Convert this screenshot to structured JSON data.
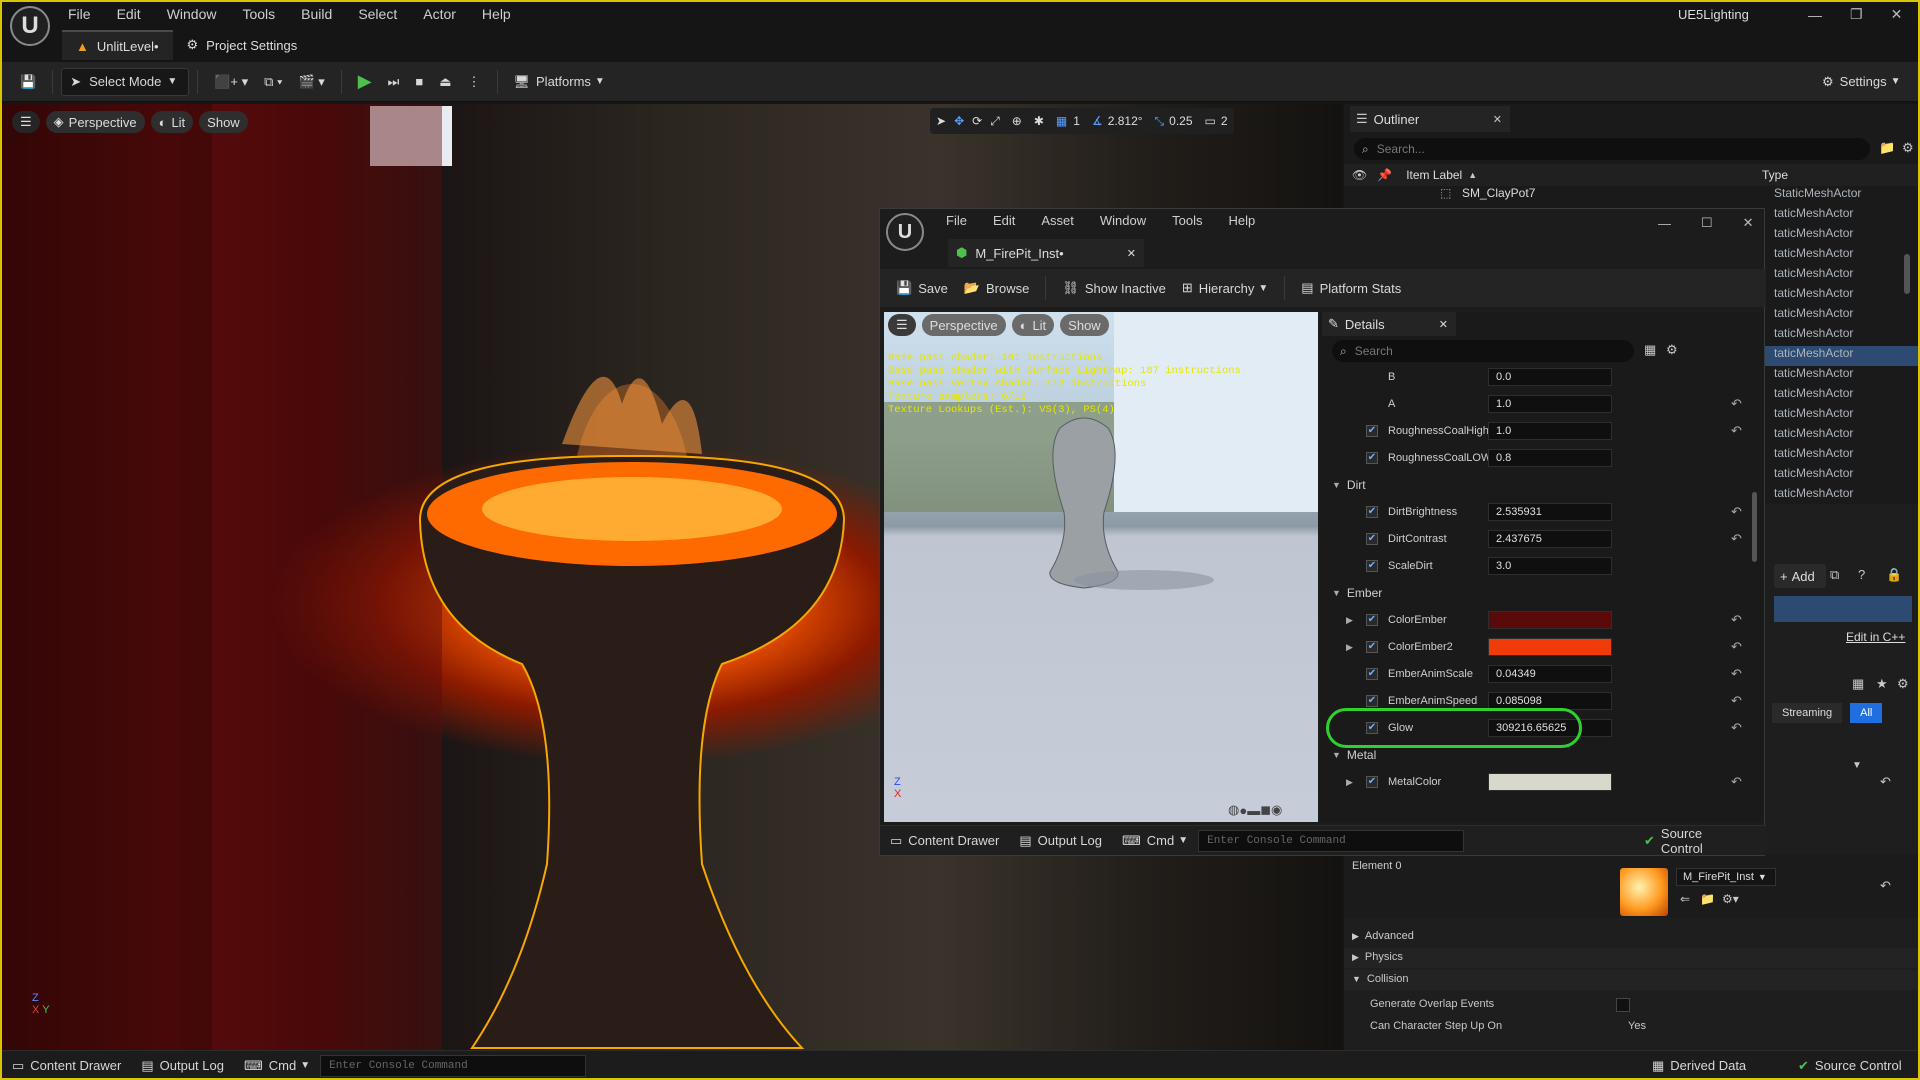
{
  "menu": [
    "File",
    "Edit",
    "Window",
    "Tools",
    "Build",
    "Select",
    "Actor",
    "Help"
  ],
  "project_name": "UE5Lighting",
  "tabs": {
    "level": "UnlitLevel•",
    "settings": "Project Settings"
  },
  "toolbar": {
    "select_mode": "Select Mode",
    "platforms": "Platforms",
    "settings": "Settings"
  },
  "viewport": {
    "perspective": "Perspective",
    "lit": "Lit",
    "show": "Show",
    "angle": "2.812°",
    "scale": "0.25",
    "grid": "1",
    "camera_speed": "2"
  },
  "material_editor": {
    "menu": [
      "File",
      "Edit",
      "Asset",
      "Window",
      "Tools",
      "Help"
    ],
    "tab": "M_FirePit_Inst•",
    "toolbar": {
      "save": "Save",
      "browse": "Browse",
      "show_inactive": "Show Inactive",
      "hierarchy": "Hierarchy",
      "platform_stats": "Platform Stats"
    },
    "preview": {
      "perspective": "Perspective",
      "lit": "Lit",
      "show": "Show",
      "stats": [
        "Base pass shader: 161 instructions",
        "Base pass shader with Surface Lightmap: 187 instructions",
        "Base pass vertex shader: 112 instructions",
        "Texture samplers: 6/16",
        "Texture Lookups (Est.): VS(3), PS(4)"
      ]
    },
    "details": {
      "tab": "Details",
      "search_placeholder": "Search",
      "rows": [
        {
          "label": "B",
          "value": "0.0"
        },
        {
          "label": "A",
          "value": "1.0"
        },
        {
          "label": "RoughnessCoalHigh",
          "value": "1.0"
        },
        {
          "label": "RoughnessCoalLOW",
          "value": "0.8"
        },
        {
          "category": "Dirt"
        },
        {
          "label": "DirtBrightness",
          "value": "2.535931"
        },
        {
          "label": "DirtContrast",
          "value": "2.437675"
        },
        {
          "label": "ScaleDirt",
          "value": "3.0"
        },
        {
          "category": "Ember"
        },
        {
          "label": "ColorEmber",
          "color": "#5a0a08"
        },
        {
          "label": "ColorEmber2",
          "color": "#f03c0a"
        },
        {
          "label": "EmberAnimScale",
          "value": "0.04349"
        },
        {
          "label": "EmberAnimSpeed",
          "value": "0.085098"
        },
        {
          "label": "Glow",
          "value": "309216.65625"
        },
        {
          "category": "Metal"
        },
        {
          "label": "MetalColor",
          "color": "#d8d8cc"
        }
      ]
    },
    "status": {
      "content_drawer": "Content Drawer",
      "output_log": "Output Log",
      "cmd": "Cmd",
      "console_placeholder": "Enter Console Command",
      "source_control": "Source Control"
    }
  },
  "outliner": {
    "title": "Outliner",
    "search_placeholder": "Search...",
    "col_label": "Item Label",
    "col_type": "Type",
    "first_item": "SM_ClayPot7",
    "first_type": "StaticMeshActor",
    "types": [
      "taticMeshActor",
      "taticMeshActor",
      "taticMeshActor",
      "taticMeshActor",
      "taticMeshActor",
      "taticMeshActor",
      "taticMeshActor",
      "taticMeshActor",
      "taticMeshActor",
      "taticMeshActor",
      "taticMeshActor",
      "taticMeshActor",
      "taticMeshActor",
      "taticMeshActor",
      "taticMeshActor"
    ]
  },
  "details_panel": {
    "add": "Add",
    "edit_cpp": "Edit in C++",
    "streaming": "Streaming",
    "all": "All",
    "element0": "Element 0",
    "material": "M_FirePit_Inst",
    "advanced": "Advanced",
    "physics": "Physics",
    "collision": "Collision",
    "gen_overlap": "Generate Overlap Events",
    "step_up": "Can Character Step Up On",
    "step_up_val": "Yes"
  },
  "statusbar": {
    "content_drawer": "Content Drawer",
    "output_log": "Output Log",
    "cmd": "Cmd",
    "console_placeholder": "Enter Console Command",
    "derived_data": "Derived Data",
    "source_control": "Source Control"
  },
  "colors": {
    "accent": "#1f6fe0",
    "highlight": "#2fd02f",
    "selection": "#f5a800"
  }
}
